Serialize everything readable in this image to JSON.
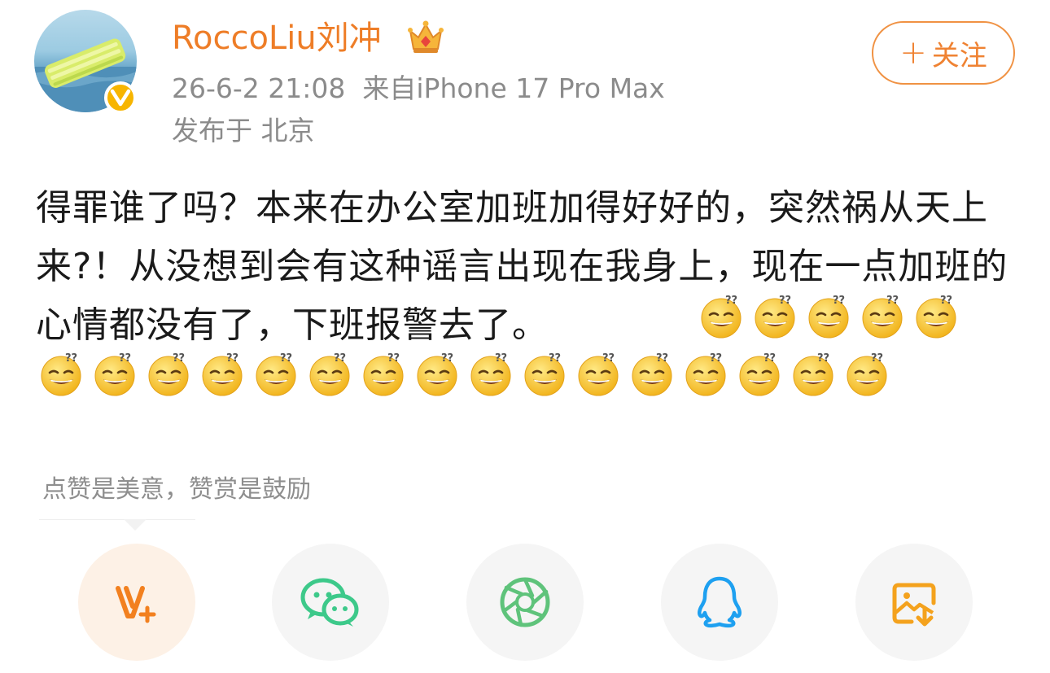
{
  "author": {
    "name": "RoccoLiu刘冲",
    "avatar_icon": "avatar-image",
    "badge_icon": "verified-v-icon",
    "crown_icon": "crown-icon"
  },
  "post_meta": {
    "time": "26-6-2 21:08",
    "source": "来自iPhone 17 Pro Max",
    "location": "发布于 北京"
  },
  "follow": {
    "label": "关注",
    "plus": "+"
  },
  "post": {
    "text": "得罪谁了吗？本来在办公室加班加得好好的，突然祸从天上来?！从没想到会有这种谣言出现在我身上，现在一点加班的心情都没有了，下班报警去了。",
    "emoji_name": "dizzy-grin-emoji",
    "emoji_count": 21
  },
  "reward_tip": "点赞是美意，赞赏是鼓励",
  "share": [
    {
      "name": "reward",
      "icon": "weibo-v-plus-icon"
    },
    {
      "name": "wechat",
      "icon": "wechat-icon"
    },
    {
      "name": "moments",
      "icon": "moments-aperture-icon"
    },
    {
      "name": "qq",
      "icon": "qq-penguin-icon"
    },
    {
      "name": "save-image",
      "icon": "save-image-icon"
    }
  ],
  "colors": {
    "accent": "#ee7d27",
    "meta_gray": "#8b8b8b",
    "wechat_green": "#3dc98a",
    "moments_green": "#5fc37b",
    "qq_blue": "#1ea0f0",
    "save_orange": "#f4a21d"
  }
}
